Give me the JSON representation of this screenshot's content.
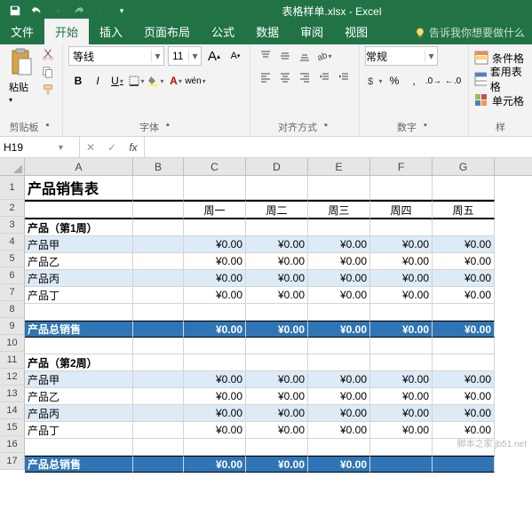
{
  "app": {
    "title": "表格样单.xlsx - Excel"
  },
  "tabs": [
    "文件",
    "开始",
    "插入",
    "页面布局",
    "公式",
    "数据",
    "审阅",
    "视图"
  ],
  "active_tab": 1,
  "tell_me": "告诉我你想要做什么",
  "ribbon": {
    "clipboard": {
      "paste": "粘贴",
      "label": "剪贴板"
    },
    "font": {
      "name": "等线",
      "size": "11",
      "grow": "A",
      "shrink": "A",
      "bold": "B",
      "italic": "I",
      "underline": "U",
      "phonetic": "wén",
      "label": "字体"
    },
    "align": {
      "label": "对齐方式"
    },
    "number": {
      "format": "常规",
      "label": "数字"
    },
    "styles": {
      "cond": "条件格",
      "table": "套用表格",
      "cell": "单元格",
      "label": "样"
    }
  },
  "name_box": "H19",
  "sheet": {
    "cols": [
      "A",
      "B",
      "C",
      "D",
      "E",
      "F",
      "G"
    ],
    "title": "产品销售表",
    "day_headers": [
      "周一",
      "周二",
      "周三",
      "周四",
      "周五"
    ],
    "week_labels": [
      "产品（第1周）",
      "产品（第2周）"
    ],
    "products": [
      "产品甲",
      "产品乙",
      "产品丙",
      "产品丁"
    ],
    "total_label": "产品总销售",
    "zero": "¥0.00"
  },
  "watermark": "脚本之家 jb51.net"
}
